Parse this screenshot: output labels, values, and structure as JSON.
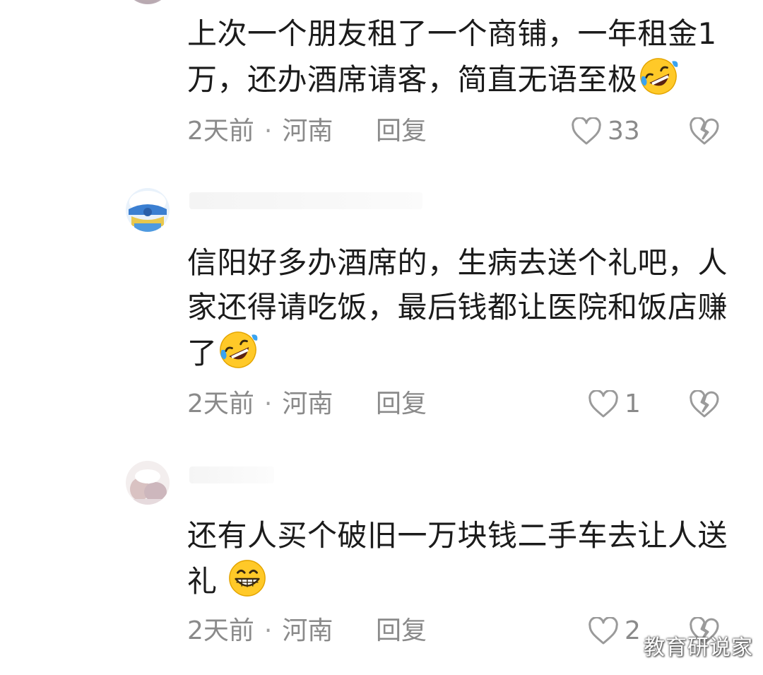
{
  "comments": [
    {
      "text": "上次一个朋友租了一个商铺，一年租金1万，还办酒席请客，简直无语至极",
      "emoji": "rofl-emoji",
      "time": "2天前",
      "location": "河南",
      "reply_label": "回复",
      "likes": "33"
    },
    {
      "text": "信阳好多办酒席的，生病去送个礼吧，人家还得请吃饭，最后钱都让医院和饭店赚了",
      "emoji": "rofl-emoji",
      "time": "2天前",
      "location": "河南",
      "reply_label": "回复",
      "likes": "1"
    },
    {
      "text": "还有人买个破旧一万块钱二手车去让人送礼",
      "emoji": "grin-emoji",
      "time": "2天前",
      "location": "河南",
      "reply_label": "回复",
      "likes": "2"
    }
  ],
  "separator": "·",
  "watermark": "教育研说家",
  "colors": {
    "text": "#1b1b1b",
    "meta": "#8a8a8a",
    "emoji_yellow": "#ffc928",
    "emoji_tears": "#3aa3f0"
  }
}
